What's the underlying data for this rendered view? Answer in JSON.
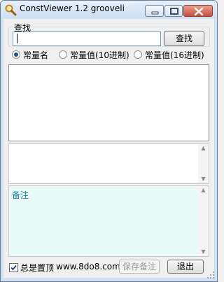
{
  "window": {
    "title": "ConstViewer 1.2 grooveli",
    "minimize_icon": "minimize-icon",
    "maximize_icon": "maximize-icon",
    "close_icon": "close-icon"
  },
  "search": {
    "group_label": "查找",
    "input_value": "",
    "button_label": "查找"
  },
  "radios": [
    {
      "label": "常量名",
      "checked": true
    },
    {
      "label": "常量值(10进制)",
      "checked": false
    },
    {
      "label": "常量值(16进制)",
      "checked": false
    }
  ],
  "note": {
    "label": "备注"
  },
  "footer": {
    "always_on_top_label": "总是置顶",
    "always_on_top_checked": true,
    "website": "www.8do8.com",
    "save_label": "保存备注",
    "exit_label": "退出"
  },
  "colors": {
    "note_background": "#e8fbf8",
    "note_label": "#1d7a96",
    "close_button": "#c7503a"
  }
}
